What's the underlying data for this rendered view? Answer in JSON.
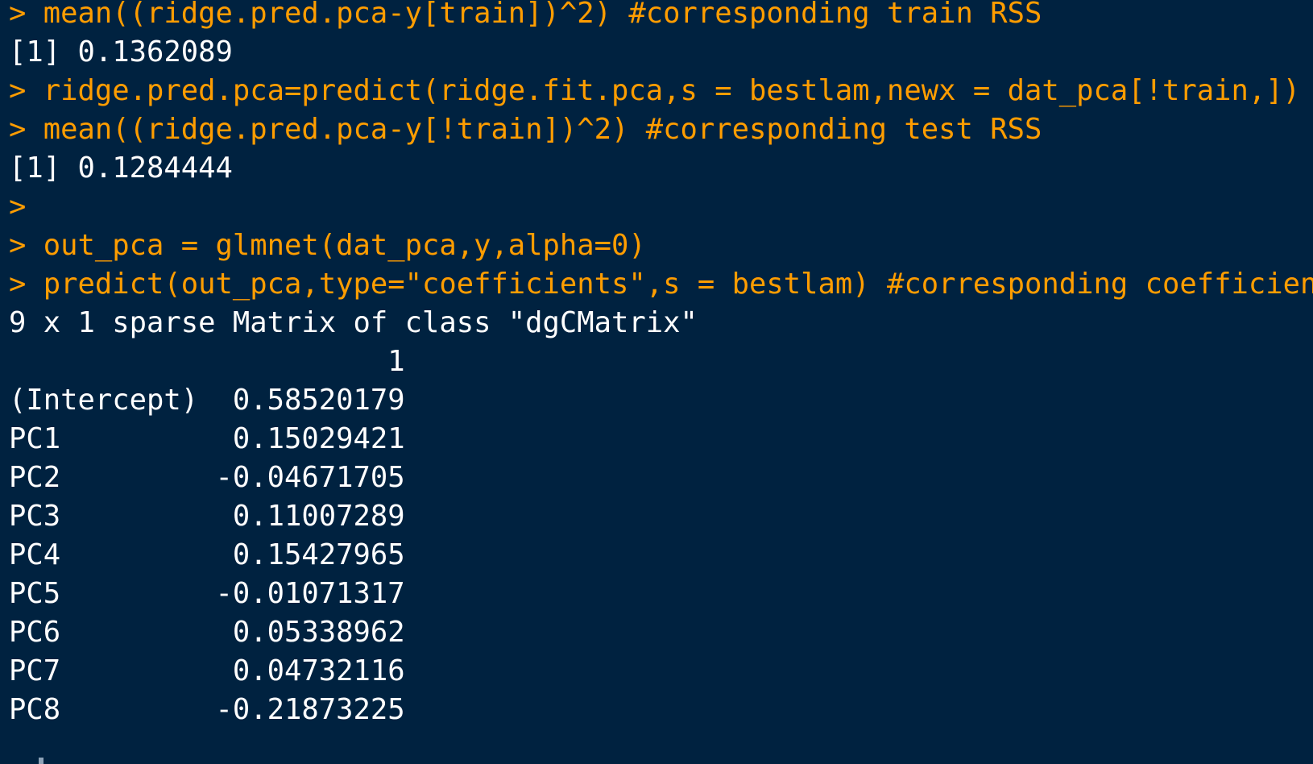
{
  "colors": {
    "background": "#002240",
    "input_text": "#ff9d00",
    "output_text": "#ffffff"
  },
  "console": {
    "lines": [
      {
        "kind": "input",
        "text": "> mean((ridge.pred.pca-y[train])^2) #corresponding train RSS"
      },
      {
        "kind": "output",
        "text": "[1] 0.1362089"
      },
      {
        "kind": "input",
        "text": "> ridge.pred.pca=predict(ridge.fit.pca,s = bestlam,newx = dat_pca[!train,])"
      },
      {
        "kind": "input",
        "text": "> mean((ridge.pred.pca-y[!train])^2) #corresponding test RSS"
      },
      {
        "kind": "output",
        "text": "[1] 0.1284444"
      },
      {
        "kind": "input",
        "text": ">"
      },
      {
        "kind": "input",
        "text": "> out_pca = glmnet(dat_pca,y,alpha=0)"
      },
      {
        "kind": "input",
        "text": "> predict(out_pca,type=\"coefficients\",s = bestlam) #corresponding coefficient"
      },
      {
        "kind": "output",
        "text": "9 x 1 sparse Matrix of class \"dgCMatrix\""
      },
      {
        "kind": "output",
        "text": "                      1"
      },
      {
        "kind": "output",
        "text": "(Intercept)  0.58520179"
      },
      {
        "kind": "output",
        "text": "PC1          0.15029421"
      },
      {
        "kind": "output",
        "text": "PC2         -0.04671705"
      },
      {
        "kind": "output",
        "text": "PC3          0.11007289"
      },
      {
        "kind": "output",
        "text": "PC4          0.15427965"
      },
      {
        "kind": "output",
        "text": "PC5         -0.01071317"
      },
      {
        "kind": "output",
        "text": "PC6          0.05338962"
      },
      {
        "kind": "output",
        "text": "PC7          0.04732116"
      },
      {
        "kind": "output",
        "text": "PC8         -0.21873225"
      }
    ]
  }
}
